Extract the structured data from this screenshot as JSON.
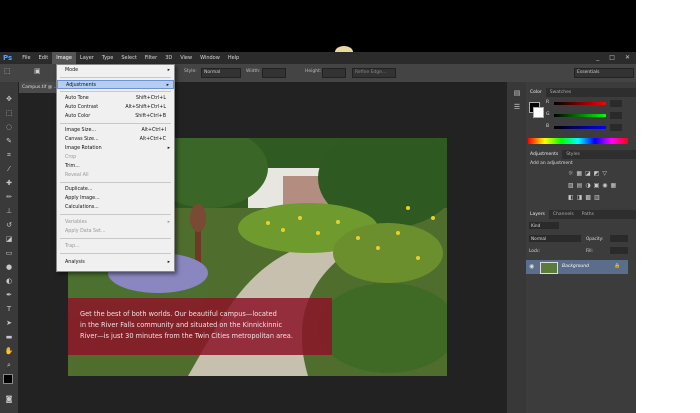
{
  "app": {
    "logo": "Ps",
    "workspace": "Essentials"
  },
  "menubar": [
    "File",
    "Edit",
    "Image",
    "Layer",
    "Type",
    "Select",
    "Filter",
    "3D",
    "View",
    "Window",
    "Help"
  ],
  "window_controls": [
    "_",
    "□",
    "✕"
  ],
  "options": {
    "style_label": "Style:",
    "style_value": "Normal",
    "width_label": "Width:",
    "height_label": "Height:",
    "refine_label": "Refine Edge..."
  },
  "doc_tab": "Campus.tif @ ...",
  "image_menu": {
    "mode": "Mode",
    "adjustments": "Adjustments",
    "auto_tone": "Auto Tone",
    "auto_tone_sc": "Shift+Ctrl+L",
    "auto_contrast": "Auto Contrast",
    "auto_contrast_sc": "Alt+Shift+Ctrl+L",
    "auto_color": "Auto Color",
    "auto_color_sc": "Shift+Ctrl+B",
    "image_size": "Image Size...",
    "image_size_sc": "Alt+Ctrl+I",
    "canvas_size": "Canvas Size...",
    "canvas_size_sc": "Alt+Ctrl+C",
    "image_rotation": "Image Rotation",
    "crop": "Crop",
    "trim": "Trim...",
    "reveal_all": "Reveal All",
    "duplicate": "Duplicate...",
    "apply_image": "Apply Image...",
    "calculations": "Calculations...",
    "variables": "Variables",
    "apply_data_set": "Apply Data Set...",
    "trap": "Trap...",
    "analysis": "Analysis"
  },
  "caption": {
    "line1": "Get the best of both worlds. Our beautiful campus—located",
    "line2": "in the River Falls community and situated on the Kinnickinnic",
    "line3": "River—is just 30 minutes from the Twin Cities metropolitan area."
  },
  "color_panel": {
    "tabs": [
      "Color",
      "Swatches"
    ],
    "r": "R",
    "g": "G",
    "b": "B"
  },
  "adjustments_panel": {
    "tabs": [
      "Adjustments",
      "Styles"
    ],
    "hint": "Add an adjustment"
  },
  "layers_panel": {
    "tabs": [
      "Layers",
      "Channels",
      "Paths"
    ],
    "kind": "Kind",
    "blend": "Normal",
    "opacity_label": "Opacity:",
    "lock_label": "Lock:",
    "fill_label": "Fill:",
    "layer_name": "Background"
  },
  "colors": {
    "accent": "#4aa8ff",
    "caption_bg": "#8c1428",
    "highlight": "#b4cdf0"
  }
}
